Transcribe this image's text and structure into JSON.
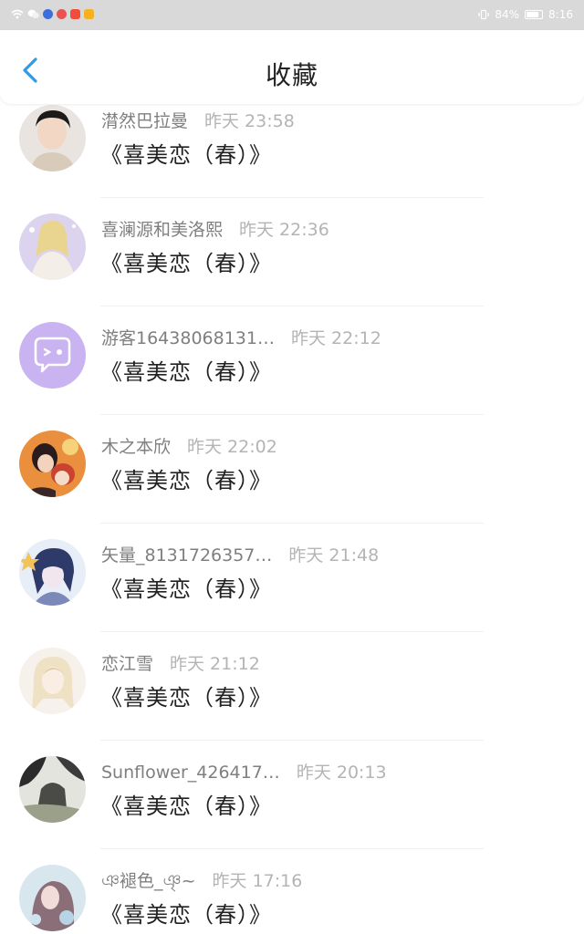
{
  "status_bar": {
    "battery": "84%",
    "battery_level": 0.84,
    "time": "8:16"
  },
  "header": {
    "title": "收藏"
  },
  "items": [
    {
      "name": "潸然巴拉曼",
      "time": "昨天 23:58",
      "book": "《喜美恋（春）》"
    },
    {
      "name": "喜澜源和美洛熙",
      "time": "昨天 22:36",
      "book": "《喜美恋（春）》"
    },
    {
      "name": "游客16438068131…",
      "time": "昨天 22:12",
      "book": "《喜美恋（春）》"
    },
    {
      "name": "木之本欣",
      "time": "昨天 22:02",
      "book": "《喜美恋（春）》"
    },
    {
      "name": "矢量_8131726357…",
      "time": "昨天 21:48",
      "book": "《喜美恋（春）》"
    },
    {
      "name": "恋江雪",
      "time": "昨天 21:12",
      "book": "《喜美恋（春）》"
    },
    {
      "name": "Sunflower_426417…",
      "time": "昨天 20:13",
      "book": "《喜美恋（春）》"
    },
    {
      "name": "ঞ褪色_ঞৃ~",
      "time": "昨天 17:16",
      "book": "《喜美恋（春）》"
    }
  ],
  "colors": {
    "accent": "#2f9be6",
    "status_bar": "#d9d9d9"
  }
}
